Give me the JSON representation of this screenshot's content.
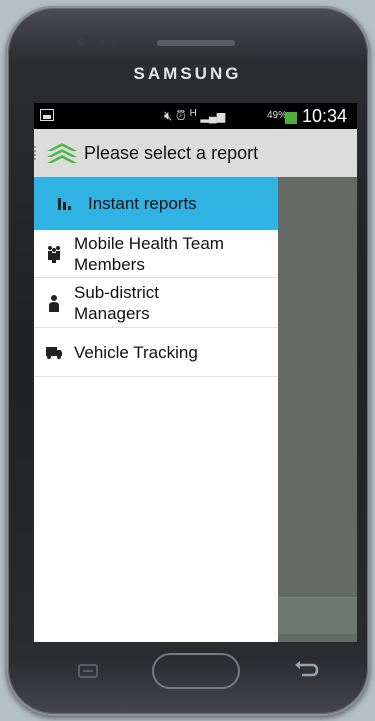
{
  "device": {
    "brand": "SAMSUNG"
  },
  "status_bar": {
    "battery_percent": "49%",
    "time": "10:34",
    "icons": [
      "image-icon",
      "mute-icon",
      "alarm-icon",
      "hsdpa-icon",
      "signal-icon",
      "battery-icon"
    ],
    "network_label": "H"
  },
  "action_bar": {
    "title": "Please select a report",
    "logo_color": "#4cb848"
  },
  "drawer": {
    "items": [
      {
        "label": "Instant reports",
        "icon": "bar-chart-icon",
        "selected": true
      },
      {
        "label": "Mobile Health Team Members",
        "icon": "team-icon",
        "selected": false
      },
      {
        "label": "Sub-district Managers",
        "icon": "manager-icon",
        "selected": false
      },
      {
        "label": "Vehicle Tracking",
        "icon": "vehicle-icon",
        "selected": false
      }
    ]
  },
  "colors": {
    "selected_item": "#30b3e3",
    "action_bar": "#dcdcdc",
    "status_bar": "#000000"
  }
}
